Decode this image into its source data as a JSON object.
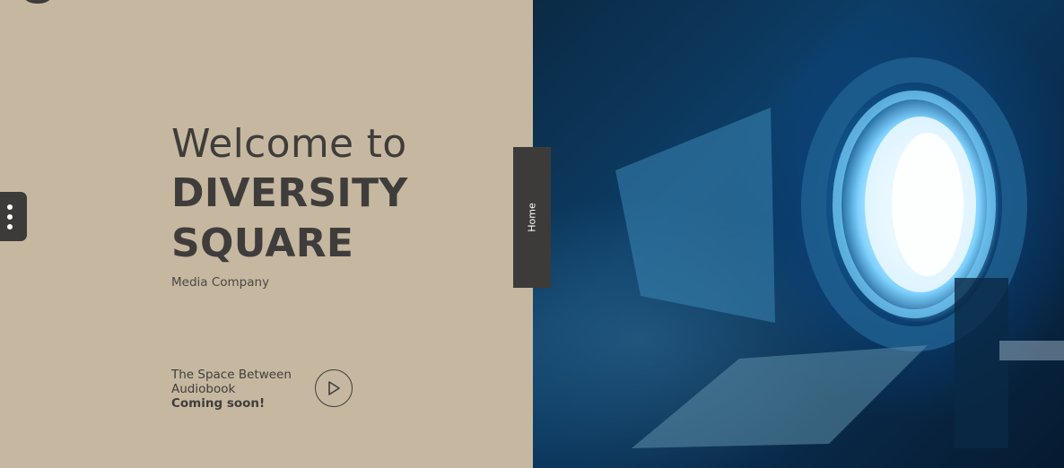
{
  "hero": {
    "welcome": "Welcome to",
    "brand_line1": "DIVERSITY",
    "brand_line2": "SQUARE",
    "subtitle": "Media Company"
  },
  "audiobook": {
    "line1": "The Space Between",
    "line2": "Audiobook",
    "status": "Coming soon!"
  },
  "side_tab": {
    "label": "Home"
  },
  "icons": {
    "menu": "more-vertical-icon",
    "play": "play-icon",
    "logo": "logo-icon"
  },
  "colors": {
    "left_background": "#c6b8a0",
    "text": "#3f3d3b",
    "tab_background": "#3c3b3a"
  }
}
